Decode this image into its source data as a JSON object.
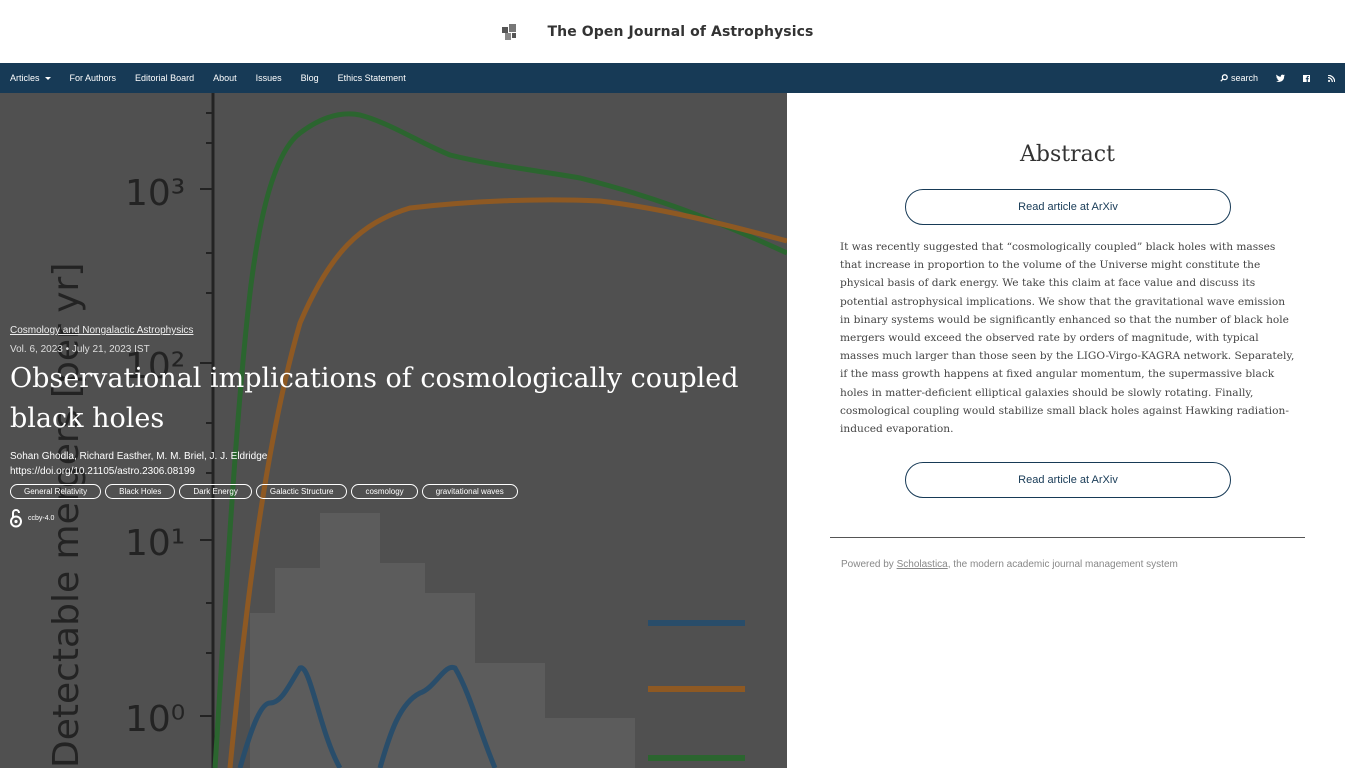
{
  "header": {
    "title": "The Open Journal of Astrophysics"
  },
  "nav": {
    "items": [
      "Articles",
      "For Authors",
      "Editorial Board",
      "About",
      "Issues",
      "Blog",
      "Ethics Statement"
    ],
    "search_label": "search",
    "icons": [
      "twitter-icon",
      "facebook-icon",
      "rss-icon"
    ]
  },
  "article": {
    "category": "Cosmology and Nongalactic Astrophysics",
    "meta": "Vol. 6, 2023 • July 21, 2023 IST",
    "title": "Observational implications of cosmologically coupled black holes",
    "authors": "Sohan Ghodla, Richard Easther, M. M. Briel, J. J. Eldridge",
    "doi": "https://doi.org/10.21105/astro.2306.08199",
    "tags": [
      "General Relativity",
      "Black Holes",
      "Dark Energy",
      "Galactic Structure",
      "cosmology",
      "gravitational waves"
    ],
    "license": "ccby-4.0",
    "figure_labels": {
      "ylabel": "Detectable mergers [per yr]",
      "y_ticks": [
        "10³",
        "10²",
        "10¹",
        "10⁰"
      ]
    }
  },
  "abstract": {
    "heading": "Abstract",
    "read_button": "Read article at ArXiv",
    "text": "It was recently suggested that “cosmologically coupled” black holes with masses that increase in proportion to the volume of the Universe might constitute the physical basis of dark energy. We take this claim at face value and discuss its potential astrophysical implications. We show that the gravitational wave emission in binary systems would be significantly enhanced so that the number of black hole mergers would exceed the observed rate by orders of magnitude, with typical masses much larger than those seen by the LIGO-Virgo-KAGRA network. Separately, if the mass growth happens at fixed angular momentum, the supermassive black holes in matter-deficient elliptical galaxies should be slowly rotating. Finally, cosmological coupling would stabilize small black holes against Hawking radiation-induced evaporation."
  },
  "footer": {
    "prefix": "Powered by ",
    "link": "Scholastica",
    "suffix": ", the modern academic journal management system"
  }
}
